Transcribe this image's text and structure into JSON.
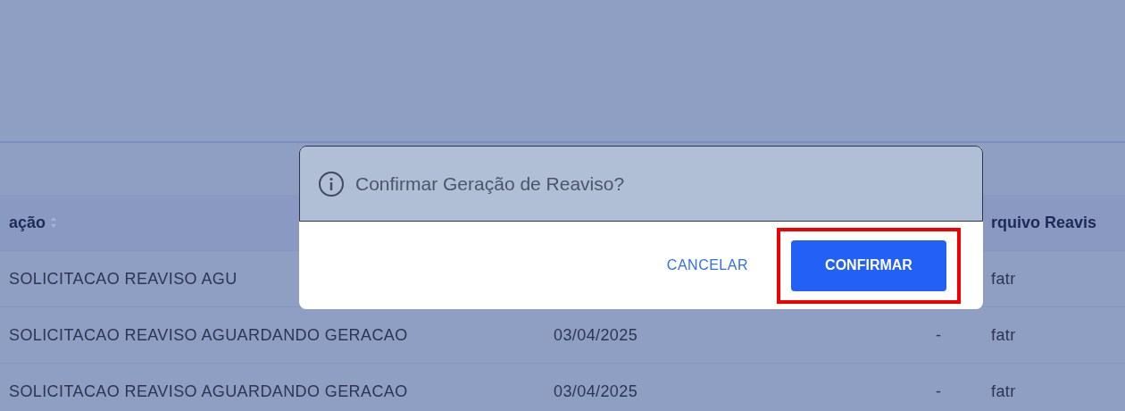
{
  "table": {
    "columns": [
      {
        "label": "ação",
        "sortable": true
      },
      {
        "label": "rquivo Reavis",
        "sortable": false
      }
    ],
    "rows": [
      {
        "status": "SOLICITACAO REAVISO AGU",
        "file": "fatr"
      },
      {
        "status": "SOLICITACAO REAVISO AGUARDANDO GERACAO",
        "date": "03/04/2025",
        "dash": "-",
        "file": "fatr"
      },
      {
        "status": "SOLICITACAO REAVISO AGUARDANDO GERACAO",
        "date": "03/04/2025",
        "dash": "-",
        "file": "fatr"
      }
    ]
  },
  "dialog": {
    "title": "Confirmar Geração de Reaviso?",
    "buttons": [
      {
        "label": "CANCELAR",
        "kind": "text",
        "highlighted": false
      },
      {
        "label": "CONFIRMAR",
        "kind": "primary",
        "highlighted": true
      }
    ]
  }
}
